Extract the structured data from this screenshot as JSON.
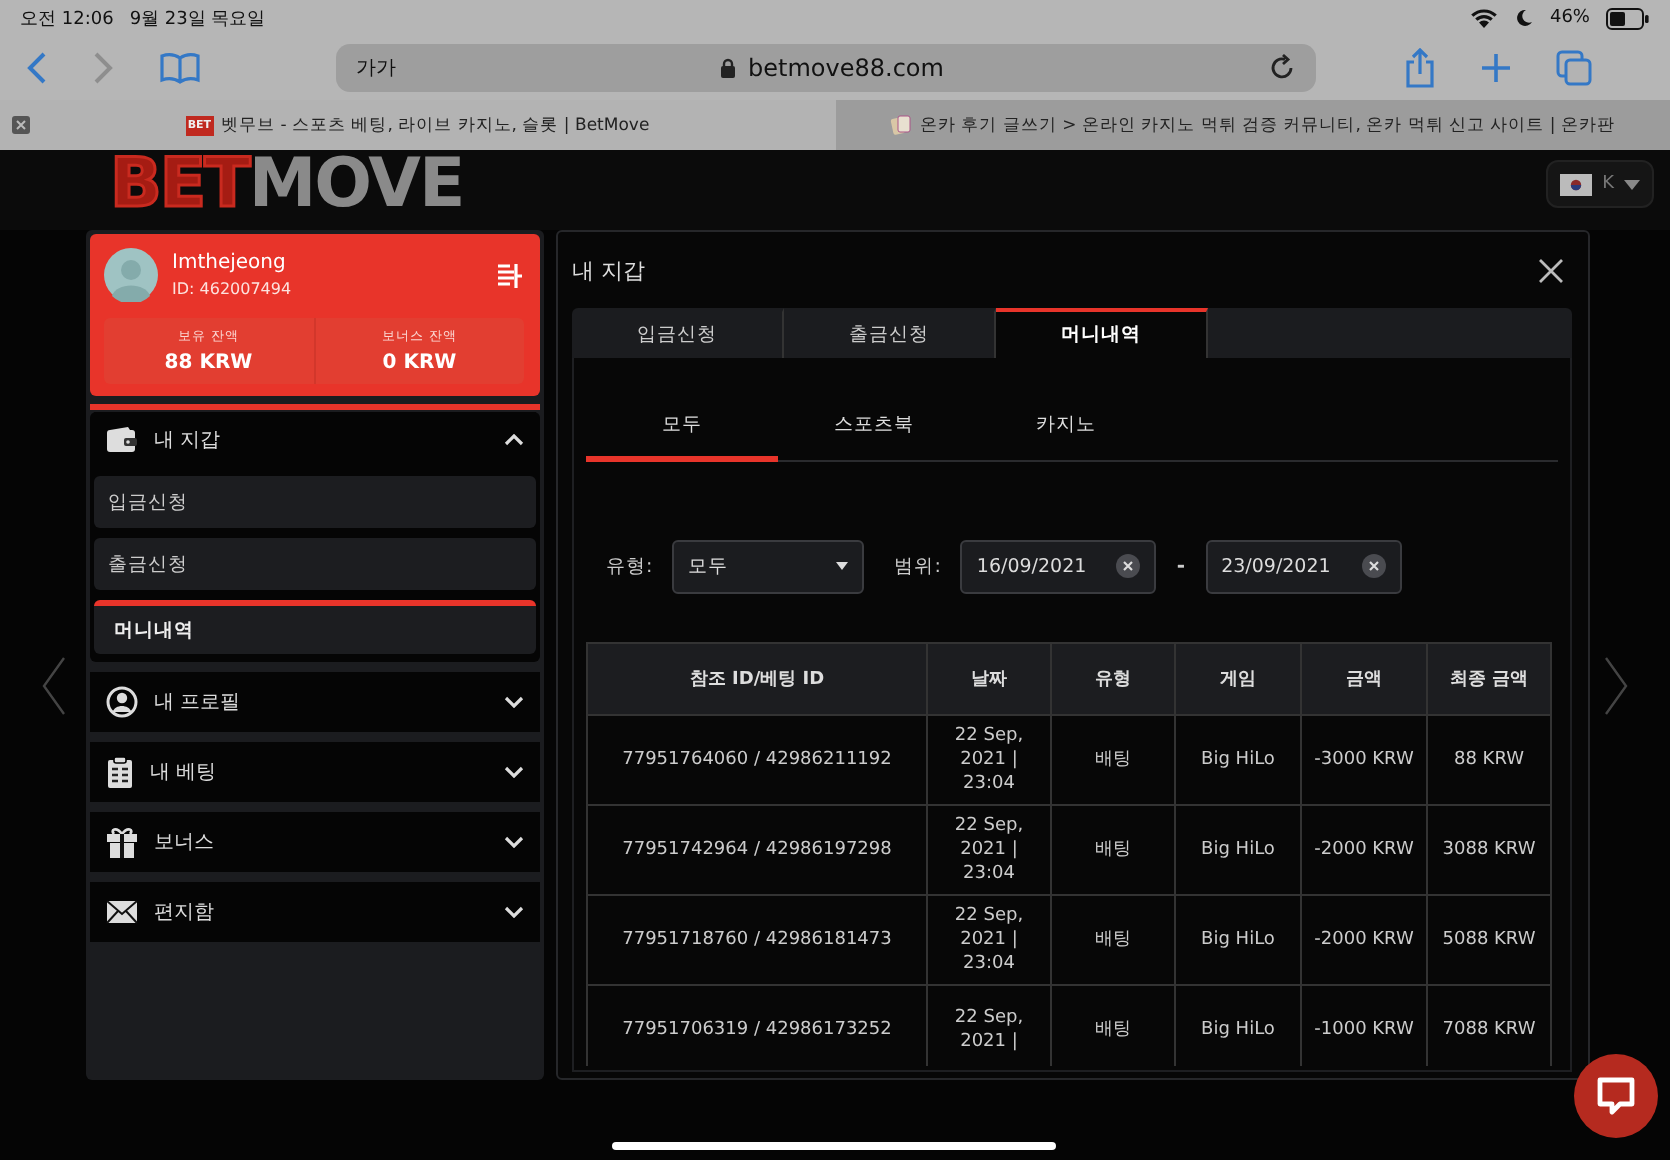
{
  "status_bar": {
    "time": "오전 12:06",
    "date": "9월 23일 목요일",
    "battery": "46%"
  },
  "browser": {
    "text_size": "가가",
    "url": "betmove88.com",
    "tabs": [
      {
        "title": "벳무브 - 스포츠 베팅, 라이브 카지노, 슬롯 | BetMove",
        "favicon": "BET",
        "selected": true
      },
      {
        "title": "온카 후기 글쓰기 > 온라인 카지노 먹튀 검증 커뮤니티, 온카 먹튀 신고 사이트 | 온카판",
        "selected": false
      }
    ]
  },
  "site": {
    "logo_left": "BET",
    "logo_right": "MOVE",
    "language": "K"
  },
  "user": {
    "name": "Imthejeong",
    "id": "ID: 462007494",
    "balances": [
      {
        "label": "보유 잔액",
        "value": "88 KRW"
      },
      {
        "label": "보너스 잔액",
        "value": "0 KRW"
      }
    ]
  },
  "menu": [
    {
      "label": "내 지갑",
      "kind": "wallet",
      "expanded": true,
      "children": [
        {
          "label": "입금신청",
          "selected": false
        },
        {
          "label": "출금신청",
          "selected": false
        },
        {
          "label": "머니내역",
          "selected": true
        }
      ]
    },
    {
      "label": "내 프로필",
      "kind": "profile",
      "expanded": false
    },
    {
      "label": "내 베팅",
      "kind": "betting",
      "expanded": false
    },
    {
      "label": "보너스",
      "kind": "bonus",
      "expanded": false
    },
    {
      "label": "편지함",
      "kind": "inbox",
      "expanded": false
    }
  ],
  "modal": {
    "title": "내 지갑",
    "tabs": [
      {
        "label": "입금신청",
        "selected": false
      },
      {
        "label": "출금신청",
        "selected": false
      },
      {
        "label": "머니내역",
        "selected": true
      }
    ],
    "subtabs": [
      {
        "label": "모두",
        "selected": true
      },
      {
        "label": "스포츠북",
        "selected": false
      },
      {
        "label": "카지노",
        "selected": false
      }
    ],
    "filters": {
      "type_label": "유형:",
      "type_value": "모두",
      "range_label": "범위:",
      "from": "16/09/2021",
      "separator": "-",
      "to": "23/09/2021"
    },
    "table": {
      "columns": [
        "참조 ID/베팅 ID",
        "날짜",
        "유형",
        "게임",
        "금액",
        "최종 금액"
      ],
      "rows": [
        [
          "77951764060 / 42986211192",
          "22 Sep, 2021 | 23:04",
          "배팅",
          "Big HiLo",
          "-3000 KRW",
          "88 KRW"
        ],
        [
          "77951742964 / 42986197298",
          "22 Sep, 2021 | 23:04",
          "배팅",
          "Big HiLo",
          "-2000 KRW",
          "3088 KRW"
        ],
        [
          "77951718760 / 42986181473",
          "22 Sep, 2021 | 23:04",
          "배팅",
          "Big HiLo",
          "-2000 KRW",
          "5088 KRW"
        ],
        [
          "77951706319 / 42986173252",
          "22 Sep, 2021 |",
          "배팅",
          "Big HiLo",
          "-1000 KRW",
          "7088 KRW"
        ]
      ]
    }
  }
}
